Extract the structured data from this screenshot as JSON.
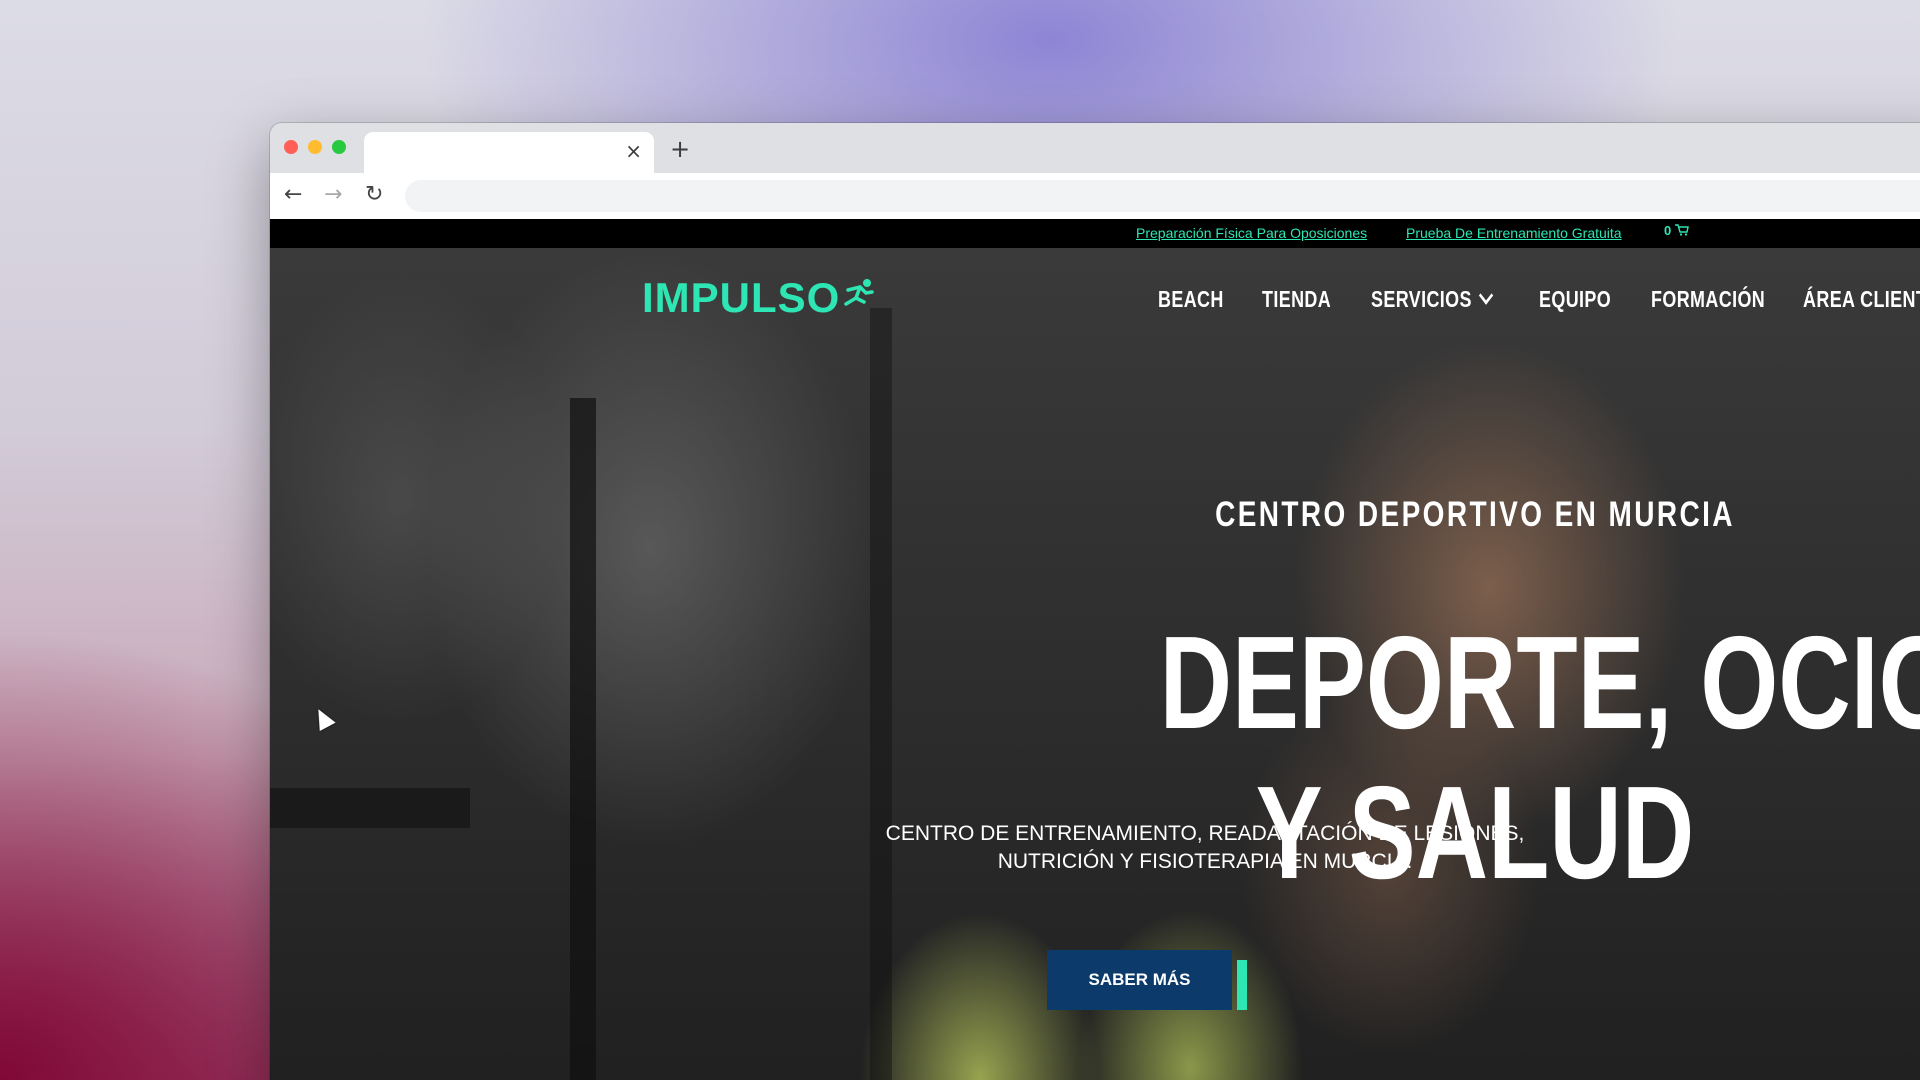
{
  "browser": {
    "tab_close_glyph": "×",
    "new_tab_glyph": "+",
    "back_glyph": "←",
    "forward_glyph": "→",
    "reload_glyph": "↻"
  },
  "topbar": {
    "links": [
      {
        "label": "Preparación Física Para Oposiciones"
      },
      {
        "label": "Prueba De Entrenamiento Gratuita"
      }
    ],
    "cart_count": "0",
    "cart_icon": "shopping-cart-icon"
  },
  "site": {
    "logo_text": "IMPULSO",
    "logo_mark": "runner-icon"
  },
  "nav": {
    "items": [
      {
        "label": "BEACH"
      },
      {
        "label": "TIENDA"
      },
      {
        "label": "SERVICIOS"
      },
      {
        "label": "EQUIPO"
      },
      {
        "label": "FORMACIÓN"
      },
      {
        "label": "ÁREA CLIENTE"
      }
    ]
  },
  "hero": {
    "kicker": "CENTRO DEPORTIVO EN MURCIA",
    "title_line1": "DEPORTE, OCIO",
    "title_line2": "Y SALUD",
    "subtitle_line1": "CENTRO DE ENTRENAMIENTO, READAPTACIÓN DE LESIONES,",
    "subtitle_line2": "NUTRICIÓN Y FISIOTERAPIA EN MURCIA.",
    "cta_label": "SABER MÁS"
  },
  "colors": {
    "accent": "#2ee6b3",
    "cta_bg": "#0c3a6a",
    "topbar_bg": "#000000"
  }
}
